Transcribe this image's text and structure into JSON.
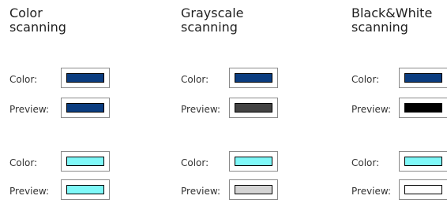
{
  "columns": [
    {
      "heading_line1": "Color",
      "heading_line2": "scanning",
      "rows": [
        {
          "label": "Color:",
          "swatch": "#0b3d80"
        },
        {
          "label": "Preview:",
          "swatch": "#0b3d80"
        },
        {
          "label": "Color:",
          "swatch": "#7ff8f8"
        },
        {
          "label": "Preview:",
          "swatch": "#7ff8f8"
        }
      ]
    },
    {
      "heading_line1": "Grayscale",
      "heading_line2": "scanning",
      "rows": [
        {
          "label": "Color:",
          "swatch": "#0b3d80"
        },
        {
          "label": "Preview:",
          "swatch": "#434343"
        },
        {
          "label": "Color:",
          "swatch": "#7ff8f8"
        },
        {
          "label": "Preview:",
          "swatch": "#d4d4d4"
        }
      ]
    },
    {
      "heading_line1": "Black&White",
      "heading_line2": "scanning",
      "rows": [
        {
          "label": "Color:",
          "swatch": "#0b3d80"
        },
        {
          "label": "Preview:",
          "swatch": "#000000"
        },
        {
          "label": "Color:",
          "swatch": "#7ff8f8"
        },
        {
          "label": "Preview:",
          "swatch": "#ffffff"
        }
      ]
    }
  ]
}
